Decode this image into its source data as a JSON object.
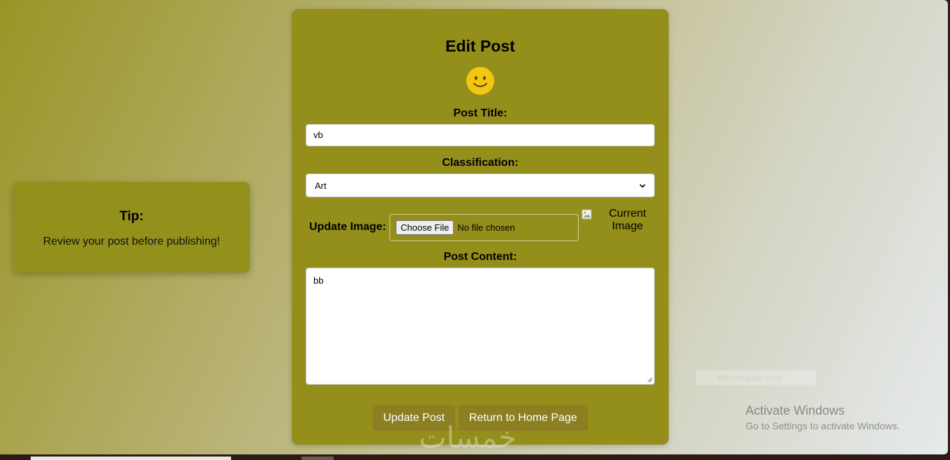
{
  "tip": {
    "title": "Tip:",
    "text": "Review your post before publishing!"
  },
  "form": {
    "heading": "Edit Post",
    "icon": "smiley-icon",
    "title_label": "Post Title:",
    "title_value": "vb",
    "classification_label": "Classification:",
    "classification_selected": "Art",
    "image_label": "Update Image:",
    "file_button_label": "Choose File",
    "file_status": "No file chosen",
    "current_image_alt": "Current Image",
    "content_label": "Post Content:",
    "content_value": "bb",
    "update_button": "Update Post",
    "home_button": "Return to Home Page"
  },
  "overlay": {
    "watermark": "خمسات",
    "snip_label": "Rectangular Snip",
    "activate_title": "Activate Windows",
    "activate_sub": "Go to Settings to activate Windows."
  },
  "colors": {
    "card_background": "#948e1a",
    "button_background": "#8b7f22",
    "smiley_yellow": "#f3c614"
  }
}
